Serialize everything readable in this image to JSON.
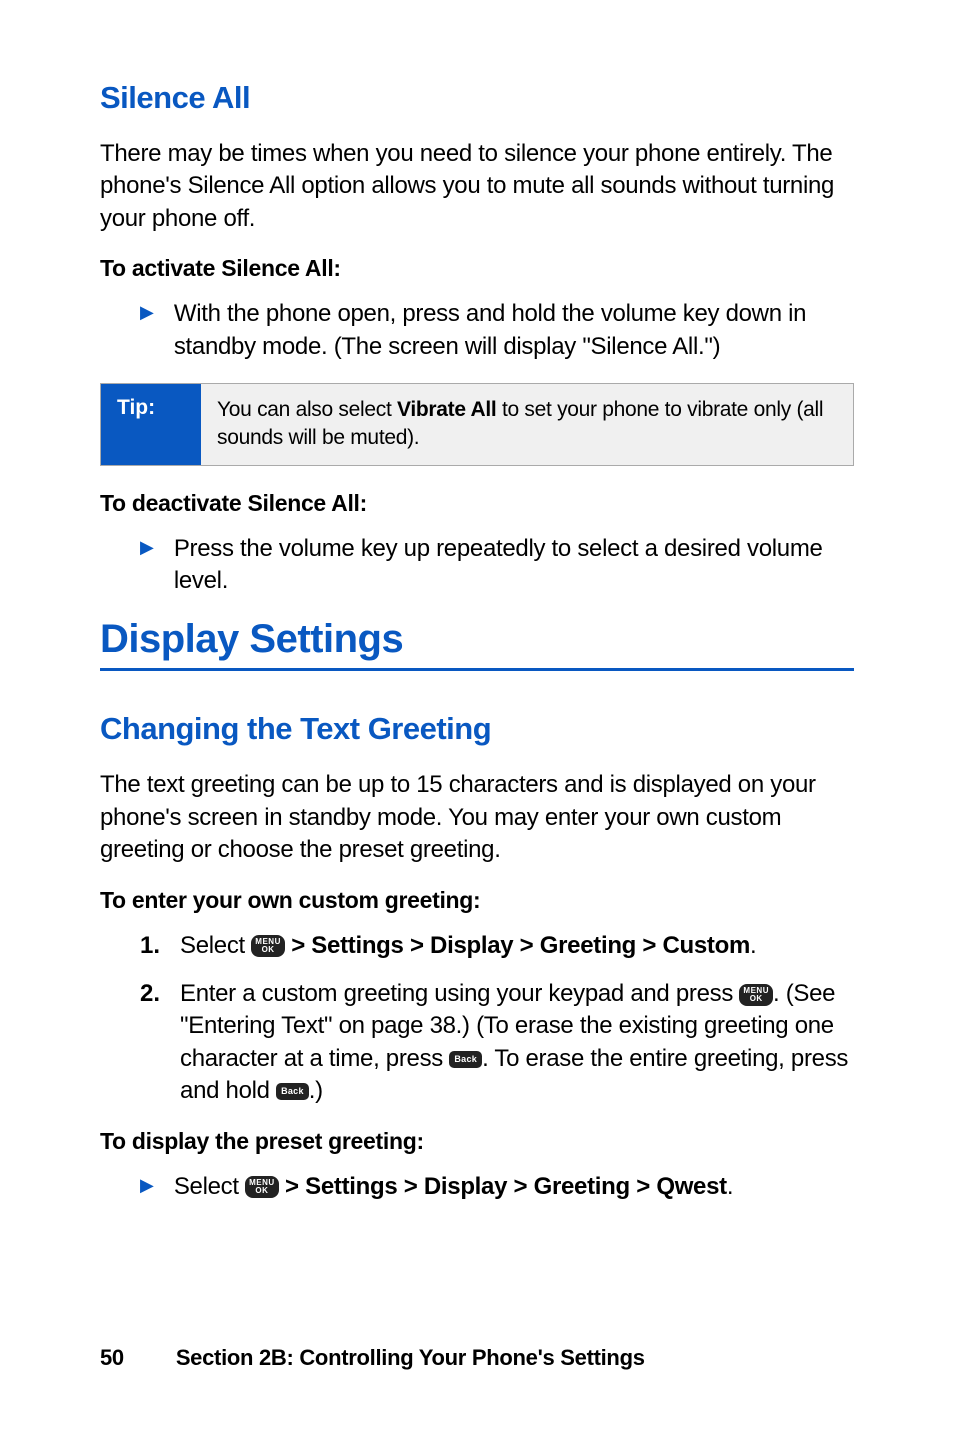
{
  "section1": {
    "heading": "Silence All",
    "intro": "There may be times when you need to silence your phone entirely. The phone's Silence All option allows you to mute all sounds without turning your phone off.",
    "activate_label": "To activate Silence All:",
    "activate_item": "With the phone open, press and hold the volume key down in standby mode. (The screen will display \"Silence All.\")",
    "tip_label": "Tip:",
    "tip_pre": "You can also select ",
    "tip_bold": "Vibrate All",
    "tip_post": " to set your phone to vibrate only (all sounds will be muted).",
    "deactivate_label": "To deactivate Silence All:",
    "deactivate_item": "Press the volume key up repeatedly to select a desired volume level."
  },
  "section2": {
    "heading": "Display Settings",
    "sub_heading": "Changing the Text Greeting",
    "intro": "The text greeting can be up to 15 characters and is displayed on your phone's screen in standby mode. You may enter your own custom greeting or choose the preset greeting.",
    "custom_label": "To enter your own custom greeting:",
    "step1_pre": "Select ",
    "step1_bold": " > Settings > Display > Greeting > Custom",
    "step1_post": ".",
    "step2_pre": "Enter a custom greeting using your keypad and press ",
    "step2_mid": ". (See \"Entering Text\" on page 38.) (To erase the existing greeting one character at a time, press ",
    "step2_mid2": ". To erase the entire greeting, press and hold ",
    "step2_post": ".)",
    "preset_label": "To display the preset greeting:",
    "preset_pre": "Select ",
    "preset_bold": " > Settings > Display > Greeting > Qwest",
    "preset_post": "."
  },
  "icons": {
    "menu_top": "MENU",
    "menu_bottom": "OK",
    "back": "Back"
  },
  "footer": {
    "page": "50",
    "title": "Section 2B: Controlling Your Phone's Settings"
  }
}
